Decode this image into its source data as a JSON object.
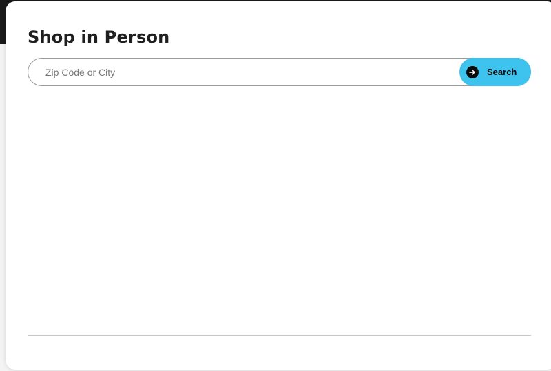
{
  "page": {
    "title": "Shop in Person"
  },
  "search": {
    "placeholder": "Zip Code or City",
    "value": "",
    "button_label": "Search",
    "button_icon": "arrow-right-circle-icon",
    "accent_color": "#3ec3ef"
  }
}
